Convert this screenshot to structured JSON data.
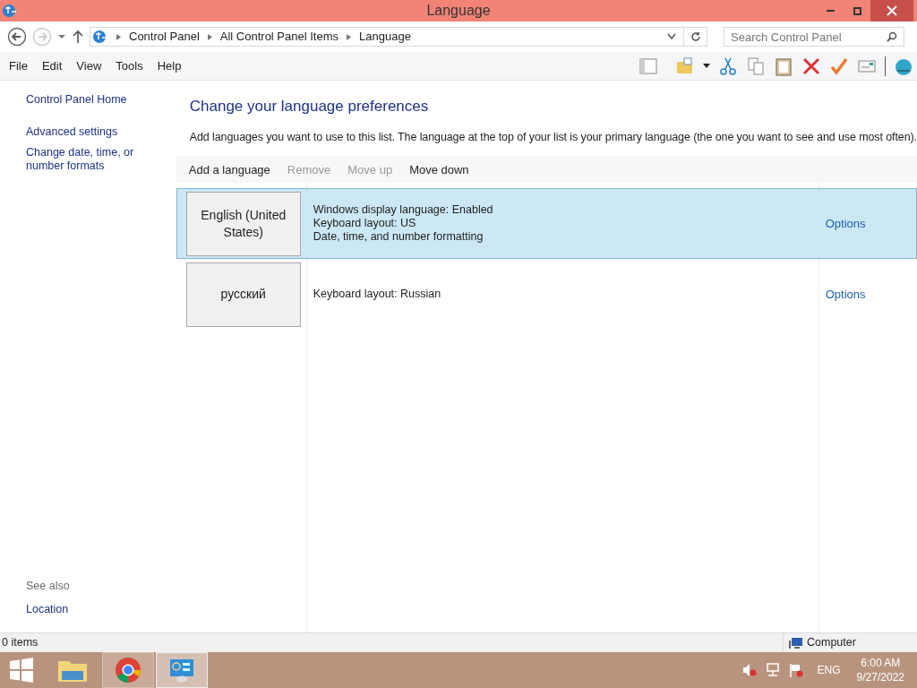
{
  "window": {
    "title": "Language"
  },
  "address_bar": {
    "breadcrumbs": [
      "Control Panel",
      "All Control Panel Items",
      "Language"
    ]
  },
  "search": {
    "placeholder": "Search Control Panel"
  },
  "menu": [
    "File",
    "Edit",
    "View",
    "Tools",
    "Help"
  ],
  "sidebar": {
    "links": [
      "Control Panel Home",
      "Advanced settings",
      "Change date, time, or number formats"
    ],
    "see_also_heading": "See also",
    "see_also_links": [
      "Location"
    ]
  },
  "main": {
    "heading": "Change your language preferences",
    "description": "Add languages you want to use to this list. The language at the top of your list is your primary language (the one you want to see and use most often).",
    "actions": [
      {
        "label": "Add a language",
        "disabled": false
      },
      {
        "label": "Remove",
        "disabled": true
      },
      {
        "label": "Move up",
        "disabled": true
      },
      {
        "label": "Move down",
        "disabled": false
      }
    ],
    "languages": [
      {
        "name": "English (United States)",
        "details": [
          "Windows display language: Enabled",
          "Keyboard layout: US",
          "Date, time, and number formatting"
        ],
        "options": "Options",
        "selected": true
      },
      {
        "name": "русский",
        "details": [
          "Keyboard layout: Russian"
        ],
        "options": "Options",
        "selected": false
      }
    ]
  },
  "status_bar": {
    "items": "0 items",
    "location": "Computer"
  },
  "taskbar": {
    "language": "ENG",
    "time": "6:00 AM",
    "date": "9/27/2022"
  }
}
